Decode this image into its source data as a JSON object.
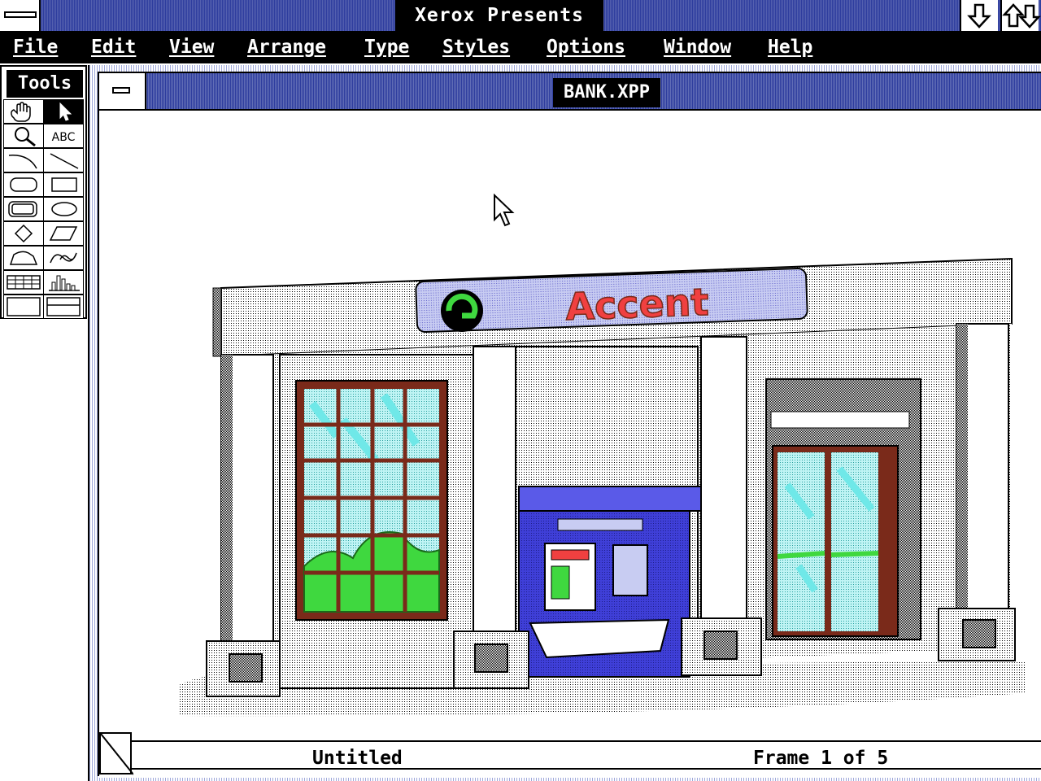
{
  "app": {
    "title": "Xerox Presents"
  },
  "menubar": {
    "items": [
      "File",
      "Edit",
      "View",
      "Arrange",
      "Type",
      "Styles",
      "Options",
      "Window",
      "Help"
    ]
  },
  "tools": {
    "title": "Tools",
    "text_tool_label": "ABC",
    "items": [
      "hand-icon",
      "pointer-icon",
      "magnifier-icon",
      "text-tool-icon",
      "arc-icon",
      "line-icon",
      "rounded-rect-icon",
      "rectangle-icon",
      "rounded-rect-shadow-icon",
      "ellipse-icon",
      "diamond-icon",
      "parallelogram-icon",
      "freeform-icon",
      "curve-icon",
      "table-icon",
      "chart-icon",
      "text-frame-icon",
      "split-frame-icon"
    ],
    "active": "pointer-icon"
  },
  "document": {
    "title": "BANK.XPP",
    "sign_text": "Accent"
  },
  "status": {
    "name": "Untitled",
    "frame": "Frame 1 of 5"
  },
  "colors": {
    "titlebar_blue": "#2e3d9e",
    "atm_blue": "#3f3fd8",
    "glass_cyan": "#6fe8e8",
    "frame_brown": "#7a2a1a",
    "sign_red": "#f04040",
    "stipple_gray": "#d8d8d8"
  }
}
